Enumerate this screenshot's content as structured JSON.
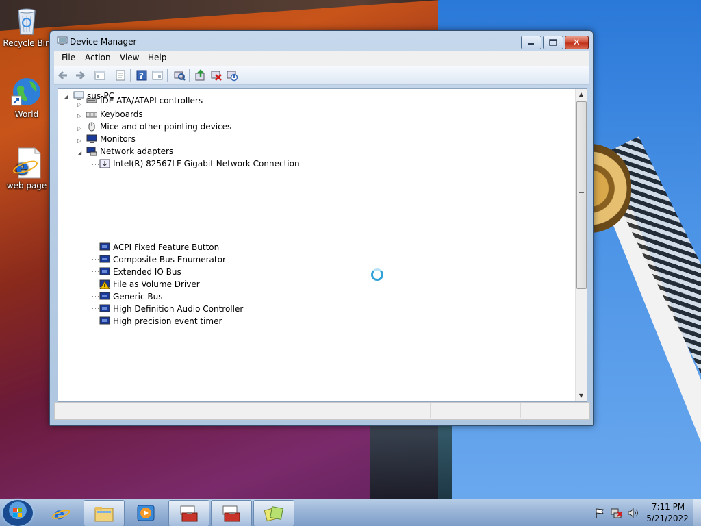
{
  "desktop": {
    "icons": [
      {
        "label": "Recycle Bin",
        "icon": "recycle-bin-icon"
      },
      {
        "label": "World",
        "icon": "globe-shortcut-icon"
      },
      {
        "label": "web page",
        "icon": "internet-explorer-file-icon"
      }
    ]
  },
  "window": {
    "title": "Device Manager",
    "icon": "device-manager-icon",
    "controls": {
      "minimize": "minimize",
      "maximize": "maximize",
      "close": "✕"
    }
  },
  "menubar": [
    "File",
    "Action",
    "View",
    "Help"
  ],
  "toolbar": {
    "buttons": [
      "back-arrow-icon",
      "forward-arrow-icon",
      "show-hide-console-tree-icon",
      "properties-icon",
      "help-icon",
      "action-pane-icon",
      "scan-hardware-icon",
      "update-driver-icon",
      "uninstall-icon",
      "disable-icon"
    ]
  },
  "tree": {
    "root": "sus-PC",
    "categories": [
      {
        "label": "IDE ATA/ATAPI controllers",
        "expanded": false,
        "icon": "ide-controller-icon"
      },
      {
        "label": "Keyboards",
        "expanded": false,
        "icon": "keyboard-icon"
      },
      {
        "label": "Mice and other pointing devices",
        "expanded": false,
        "icon": "mouse-icon"
      },
      {
        "label": "Monitors",
        "expanded": false,
        "icon": "monitor-icon"
      },
      {
        "label": "Network adapters",
        "expanded": true,
        "icon": "network-adapter-icon",
        "children": [
          "Intel(R) 82567LF Gigabit Network Connection"
        ]
      }
    ],
    "system_devices": [
      {
        "label": "ACPI Fixed Feature Button",
        "warning": false
      },
      {
        "label": "Composite Bus Enumerator",
        "warning": false
      },
      {
        "label": "Extended IO Bus",
        "warning": false
      },
      {
        "label": "File as Volume Driver",
        "warning": true
      },
      {
        "label": "Generic Bus",
        "warning": false
      },
      {
        "label": "High Definition Audio Controller",
        "warning": false
      },
      {
        "label": "High precision event timer",
        "warning": false
      }
    ]
  },
  "taskbar": {
    "apps": [
      {
        "name": "internet-explorer",
        "open": false
      },
      {
        "name": "windows-explorer",
        "open": true
      },
      {
        "name": "media-player",
        "open": false
      },
      {
        "name": "toolbox-1",
        "open": true
      },
      {
        "name": "toolbox-2",
        "open": true
      },
      {
        "name": "sticky-notes",
        "open": true
      }
    ],
    "clock": {
      "time": "7:11 PM",
      "date": "5/21/2022"
    }
  },
  "colors": {
    "accent": "#2fa3d8",
    "warning": "#f2c200"
  }
}
